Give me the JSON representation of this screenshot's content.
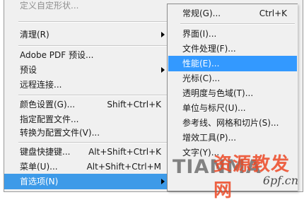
{
  "left_menu": {
    "items": [
      {
        "label": "定义自定形状...",
        "shortcut": "",
        "disabled": true,
        "submenu": false
      },
      {
        "label": "清理(R)",
        "shortcut": "",
        "disabled": false,
        "submenu": true
      },
      {
        "label": "Adobe PDF 预设...",
        "shortcut": "",
        "disabled": false,
        "submenu": false
      },
      {
        "label": "预设",
        "shortcut": "",
        "disabled": false,
        "submenu": true
      },
      {
        "label": "远程连接...",
        "shortcut": "",
        "disabled": false,
        "submenu": false
      },
      {
        "label": "颜色设置(G)...",
        "shortcut": "Shift+Ctrl+K",
        "disabled": false,
        "submenu": false
      },
      {
        "label": "指定配置文件...",
        "shortcut": "",
        "disabled": false,
        "submenu": false
      },
      {
        "label": "转换为配置文件(V)...",
        "shortcut": "",
        "disabled": false,
        "submenu": false
      },
      {
        "label": "键盘快捷键...",
        "shortcut": "Alt+Shift+Ctrl+K",
        "disabled": false,
        "submenu": false
      },
      {
        "label": "菜单(U)...",
        "shortcut": "Alt+Shift+Ctrl+M",
        "disabled": false,
        "submenu": false
      },
      {
        "label": "首选项(N)",
        "shortcut": "",
        "disabled": false,
        "submenu": true,
        "selected": true
      }
    ]
  },
  "submenu": {
    "items": [
      {
        "label": "常规(G)...",
        "shortcut": "Ctrl+K"
      },
      {
        "label": "界面(I)...",
        "shortcut": ""
      },
      {
        "label": "文件处理(F)...",
        "shortcut": ""
      },
      {
        "label": "性能(E)...",
        "shortcut": "",
        "selected": true
      },
      {
        "label": "光标(C)...",
        "shortcut": ""
      },
      {
        "label": "透明度与色域(T)...",
        "shortcut": ""
      },
      {
        "label": "单位与标尺(U)...",
        "shortcut": ""
      },
      {
        "label": "参考线、网格和切片(S)...",
        "shortcut": ""
      },
      {
        "label": "增效工具(P)...",
        "shortcut": ""
      },
      {
        "label": "文字(Y)...",
        "shortcut": ""
      }
    ]
  },
  "watermark": {
    "latin": "TIANMA",
    "cjk": "资源教发网",
    "url": "6pf.cn"
  },
  "colors": {
    "menu_bg": "#f0f0f0",
    "highlight": "#3399ff",
    "highlight_text": "#ffffff",
    "disabled_text": "#8f8f8f"
  }
}
